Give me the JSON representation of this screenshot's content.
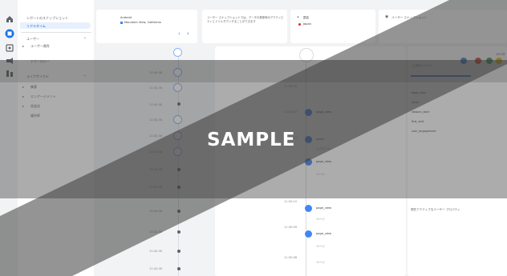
{
  "sidebar": {
    "header": "レポートのスナップショット",
    "realtime_label": "リアルタイム",
    "sections": [
      {
        "label": "ユーザー",
        "items": [
          "ユーザー属性",
          "テクノロジー"
        ]
      },
      {
        "label": "ライフサイクル",
        "items": [
          "集客",
          "エンゲージメント",
          "収益化",
          "維持率"
        ]
      }
    ]
  },
  "top_cards": {
    "user_card": {
      "title": "Android",
      "subtitle": "Mountain View, California"
    },
    "info_text": "ユーザー スナップショットでは、データの更新時のアクティビティにドリルダウンすることができます",
    "location_card": {
      "label": "国名",
      "value": "Japan"
    },
    "snapshot_card": {
      "label": "ユーザー スナップショット"
    }
  },
  "timeline": {
    "left_times": [
      "11:42:30",
      "11:42:30",
      "11:42:30",
      "11:42:30",
      "11:42:30",
      "11:42:30",
      "11:42:30",
      "11:42:30",
      "11:42:30",
      "11:42:30",
      "11:42:30",
      "11:42:30"
    ],
    "main_times": [
      "11:30:15",
      "11:30:12",
      "11:30:11",
      "11:30:10",
      "11:30:09",
      "11:30:08"
    ],
    "events": [
      "page_view",
      "scroll",
      "page_view",
      "page_view"
    ],
    "sub_labels": [
      "スクロール",
      "ページ",
      "ページ",
      "ページ"
    ]
  },
  "right_panel": {
    "header": "上位のイベント",
    "count": "100 件",
    "rows": [
      {
        "name": "page_view",
        "val": "10"
      },
      {
        "name": "scroll",
        "val": "8"
      },
      {
        "name": "session_start",
        "val": "6"
      },
      {
        "name": "first_visit",
        "val": "3"
      },
      {
        "name": "user_engagement",
        "val": "2"
      }
    ],
    "footer": "現在アクティブなユーザー プロパティ"
  },
  "watermark": "SAMPLE"
}
